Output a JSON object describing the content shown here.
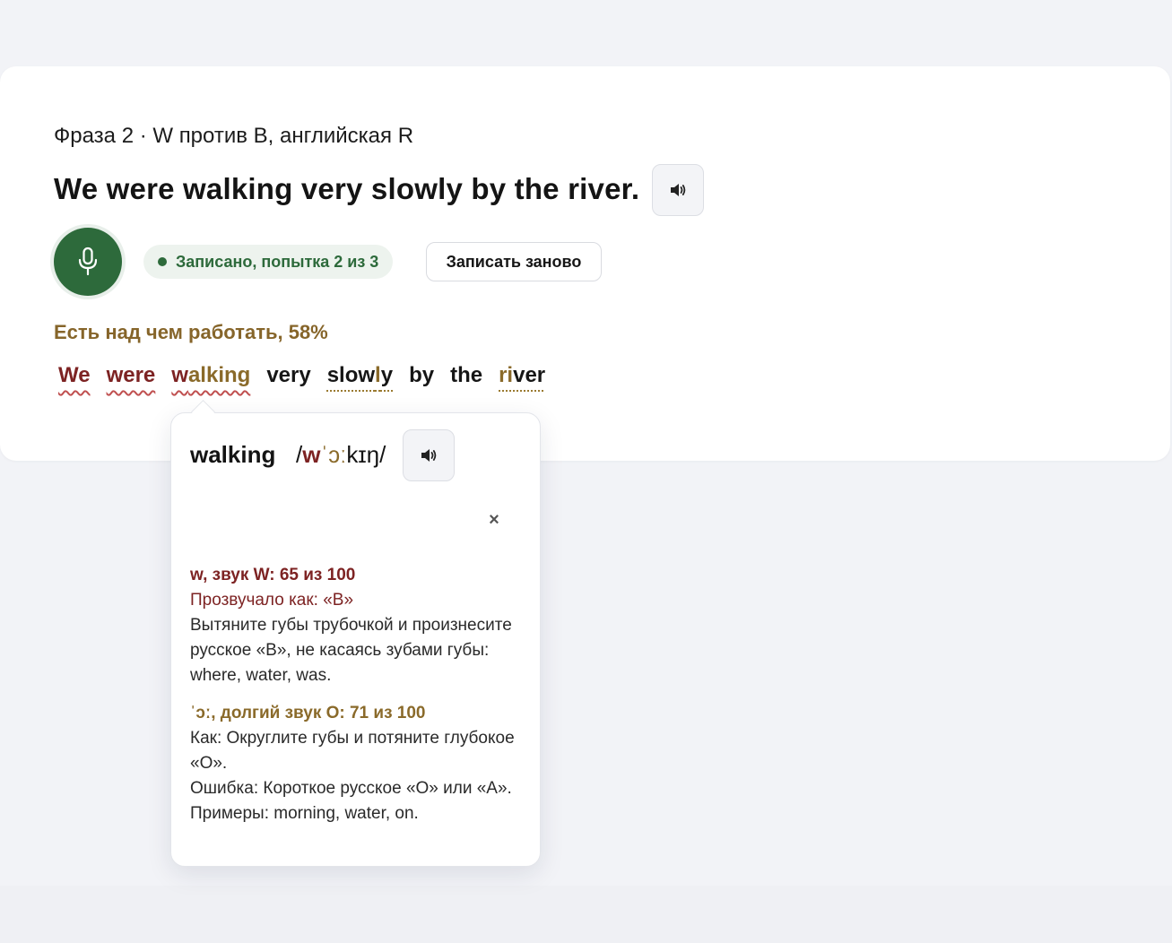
{
  "subtitle": "Фраза 2 · W против В, английская R",
  "phrase": "We were walking very slowly by the river.",
  "icons": {
    "speaker": "speaker-icon",
    "mic": "microphone-icon",
    "close": "close-icon"
  },
  "colors": {
    "accent_green": "#2d6a3b",
    "error_red": "#7d2323",
    "warn_amber": "#8a6a2a"
  },
  "status": {
    "text": "Записано, попытка 2 из 3"
  },
  "rerecord_label": "Записать заново",
  "score_text": "Есть над чем работать, 58%",
  "words": {
    "we": {
      "p1": "We",
      "p2": ""
    },
    "were": {
      "p1": "were",
      "p2": ""
    },
    "walking": {
      "p1": "w",
      "p2": "alking"
    },
    "very": {
      "p1": "very"
    },
    "slowly": {
      "p1": "slow",
      "p2": "l",
      "p3": "y"
    },
    "by": {
      "p1": "by"
    },
    "the": {
      "p1": "the"
    },
    "river": {
      "p1": "ri",
      "p2": "ver"
    }
  },
  "popover": {
    "word": "walking",
    "ipa": {
      "open": "/",
      "p1": "w",
      "p2": "ˈɔː",
      "p3": "kɪŋ",
      "close": "/"
    },
    "close_label": "×",
    "issue1": {
      "heading": "w, звук W: 65 из 100",
      "heard": "Прозвучало как: «В»",
      "tip": "Вытяните губы трубочкой и произнесите русское «В», не касаясь зубами губы: where, water, was."
    },
    "issue2": {
      "heading": "ˈɔː, долгий звук O: 71 из 100",
      "how": "Как: Округлите губы и потяните глубокое «О».",
      "mistake": "Ошибка: Короткое русское «О» или «А».",
      "examples": "Примеры: morning, water, on."
    }
  }
}
